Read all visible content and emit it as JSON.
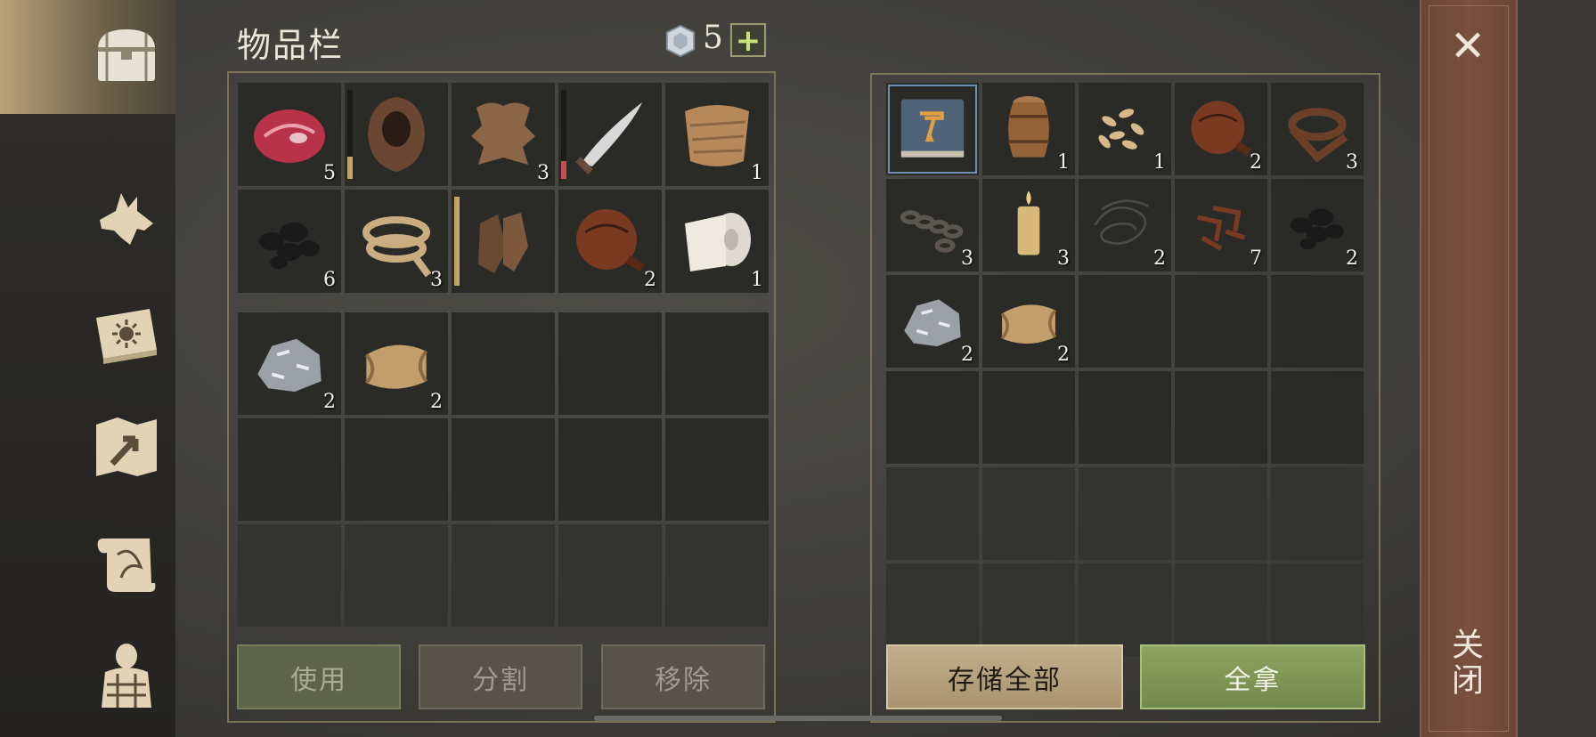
{
  "inventory": {
    "title": "物品栏",
    "gem_count": "5",
    "add_label": "+"
  },
  "left_bag": [
    {
      "icon": "raw-meat-icon",
      "qty": "5",
      "durability": null
    },
    {
      "icon": "hood-icon",
      "qty": "",
      "durability": 0.25
    },
    {
      "icon": "hide-icon",
      "qty": "3",
      "durability": null
    },
    {
      "icon": "machete-icon",
      "qty": "",
      "durability": 0.2
    },
    {
      "icon": "cloth-icon",
      "qty": "1",
      "durability": null
    },
    {
      "icon": "coal-icon",
      "qty": "6",
      "durability": null
    },
    {
      "icon": "rope-icon",
      "qty": "3",
      "durability": null
    },
    {
      "icon": "gloves-icon",
      "qty": "",
      "durability": 1.0
    },
    {
      "icon": "waterskin-icon",
      "qty": "2",
      "durability": null
    },
    {
      "icon": "bandage-icon",
      "qty": "1",
      "durability": null
    }
  ],
  "left_extra": [
    {
      "icon": "iron-ore-icon",
      "qty": "2"
    },
    {
      "icon": "leather-roll-icon",
      "qty": "2"
    }
  ],
  "right_storage": [
    {
      "icon": "blueprint-book-icon",
      "qty": ""
    },
    {
      "icon": "barrel-icon",
      "qty": "1"
    },
    {
      "icon": "seeds-icon",
      "qty": "1"
    },
    {
      "icon": "waterskin-icon",
      "qty": "2"
    },
    {
      "icon": "leather-strap-icon",
      "qty": "3"
    },
    {
      "icon": "chain-icon",
      "qty": "3"
    },
    {
      "icon": "candle-icon",
      "qty": "3"
    },
    {
      "icon": "wire-icon",
      "qty": "2"
    },
    {
      "icon": "scrap-metal-icon",
      "qty": "7"
    },
    {
      "icon": "coal-icon",
      "qty": "2"
    },
    {
      "icon": "iron-ore-icon",
      "qty": "2"
    },
    {
      "icon": "leather-roll-icon",
      "qty": "2"
    }
  ],
  "buttons": {
    "use": "使用",
    "split": "分割",
    "remove": "移除",
    "store_all": "存储全部",
    "take_all": "全拿"
  },
  "close": {
    "x": "✕",
    "label": "关闭"
  },
  "sidebar": [
    "chest-icon",
    "wolf-icon",
    "sun-book-icon",
    "map-icon",
    "quest-scroll-icon",
    "character-icon"
  ],
  "colors": {
    "accent_green": "#8da460",
    "accent_tan": "#c1ae8b",
    "close_red": "#7a5040"
  }
}
